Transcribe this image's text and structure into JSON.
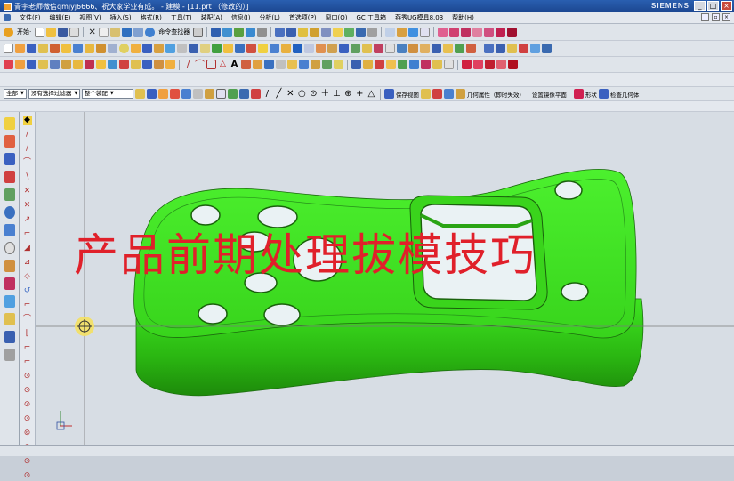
{
  "titlebar": {
    "title": "青宇老师微信qmjyj6666、祝大家学业有成。 - 建模 - [11.prt （修改的）]",
    "brand": "SIEMENS"
  },
  "menu": {
    "items": [
      "文件(F)",
      "编辑(E)",
      "视图(V)",
      "插入(S)",
      "格式(R)",
      "工具(T)",
      "装配(A)",
      "信息(I)",
      "分析(L)",
      "首选项(P)",
      "窗口(O)",
      "GC 工具箱",
      "燕秀UG模具8.03",
      "帮助(H)"
    ]
  },
  "toolbar1": {
    "start_label": "开始·",
    "command_finder_label": "命令查找器"
  },
  "selection_bar": {
    "filter_all": "全部",
    "filter_type": "没有选择过滤器",
    "scope": "整个装配"
  },
  "view_bar": {
    "save_view": "保存视图",
    "geometry_properties": "几何属性（即时失效）",
    "set_mirror_plane": "设置镜像平面",
    "shape_label": "形状",
    "check_geometry": "检查几何体"
  },
  "overlay": {
    "title": "产品前期处理拔模技巧"
  },
  "colors": {
    "part_green": "#3fe020",
    "title_red": "#e0202a",
    "viewport_bg": "#d7dde4"
  }
}
